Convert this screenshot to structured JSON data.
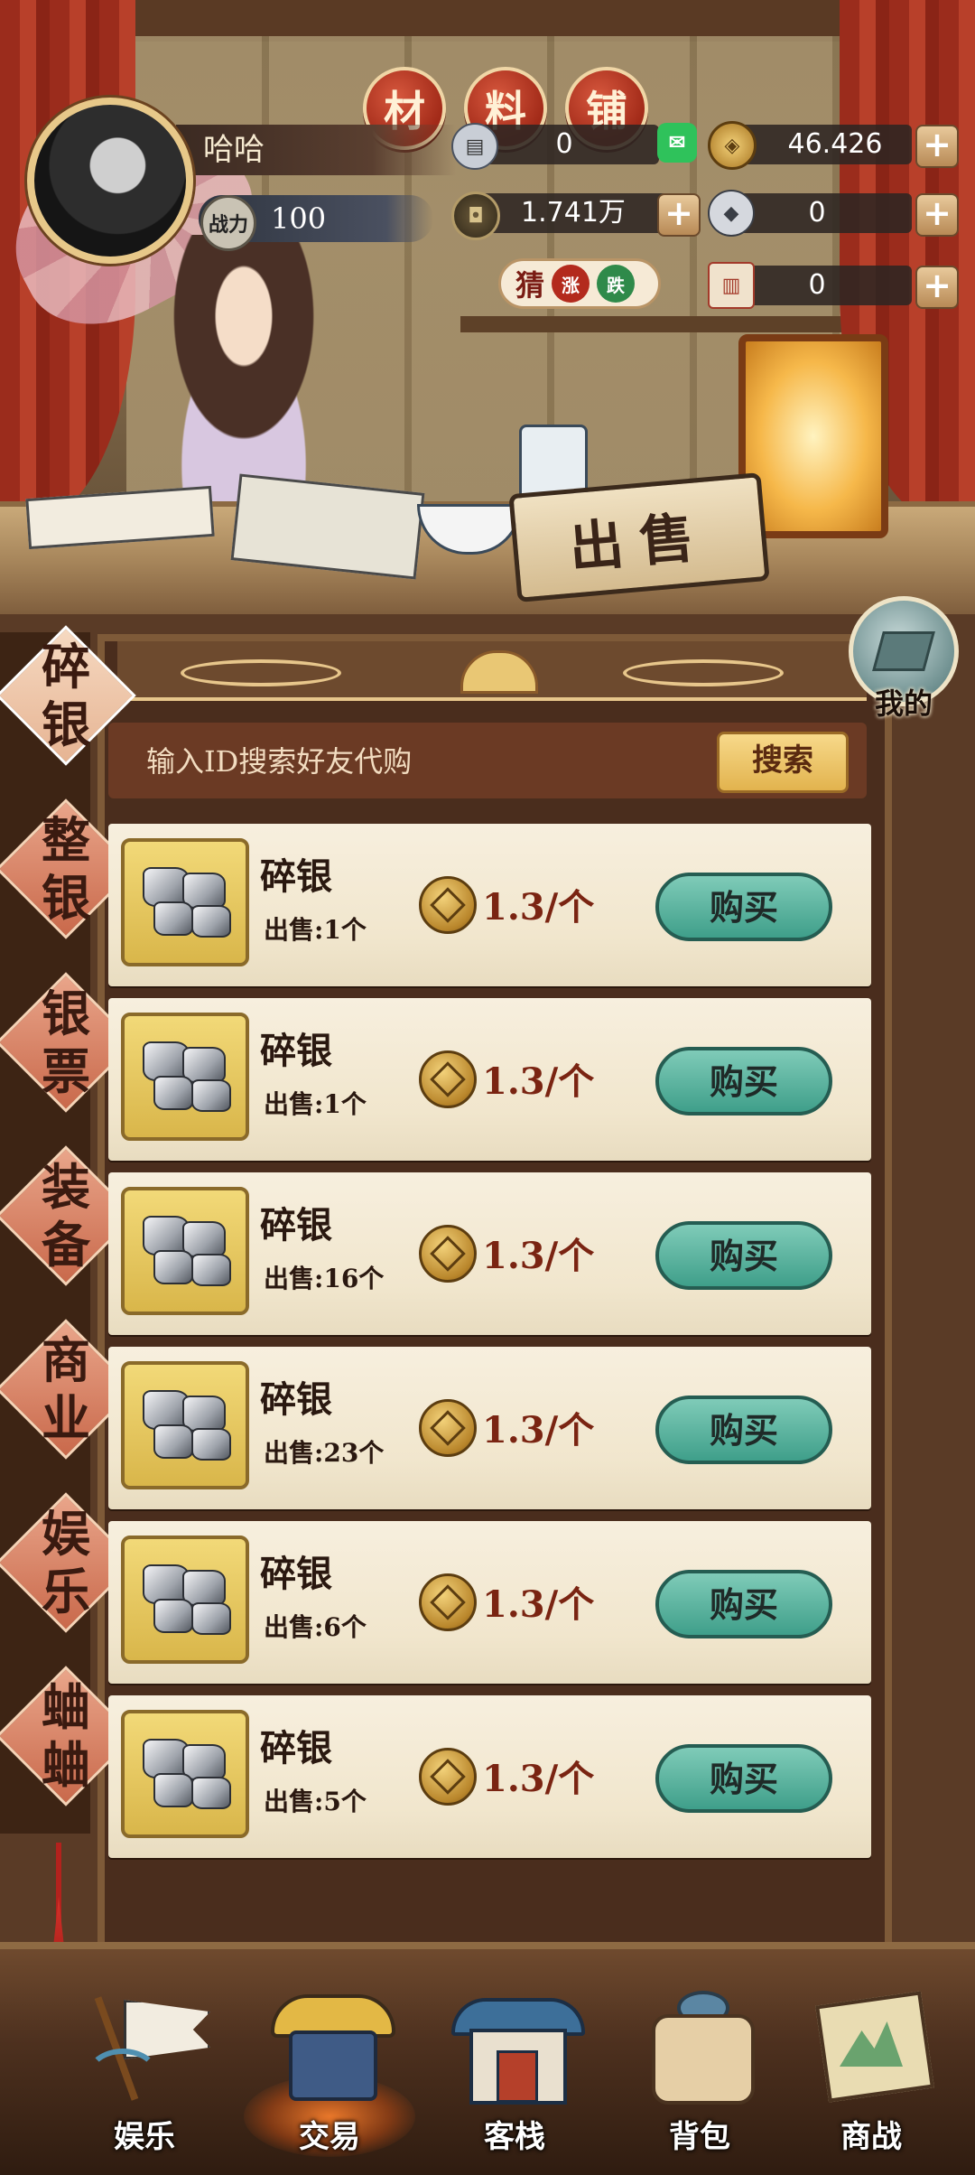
{
  "shop_title": [
    "材",
    "料",
    "铺"
  ],
  "player": {
    "name": "哈哈",
    "power_icon_label": "战力",
    "power": "100"
  },
  "resources": {
    "silver_bills": "0",
    "gold_ingots": "46.426",
    "copper_coins": "1.741万",
    "silver_chunks": "0",
    "tickets": "0"
  },
  "guess_badge": {
    "label": "猜",
    "rise": "涨",
    "fall": "跌"
  },
  "sell_sign": "出售",
  "mine_button": "我的",
  "side_tabs": [
    {
      "label": "碎银",
      "active": true
    },
    {
      "label": "整银",
      "active": false
    },
    {
      "label": "银票",
      "active": false
    },
    {
      "label": "装备",
      "active": false
    },
    {
      "label": "商业",
      "active": false
    },
    {
      "label": "娱乐",
      "active": false
    },
    {
      "label": "蛐蛐",
      "active": false
    }
  ],
  "search": {
    "placeholder": "输入ID搜索好友代购",
    "button": "搜索"
  },
  "listings": [
    {
      "name": "碎银",
      "sold": "出售:1个",
      "price": "1.3/个",
      "buy": "购买"
    },
    {
      "name": "碎银",
      "sold": "出售:1个",
      "price": "1.3/个",
      "buy": "购买"
    },
    {
      "name": "碎银",
      "sold": "出售:16个",
      "price": "1.3/个",
      "buy": "购买"
    },
    {
      "name": "碎银",
      "sold": "出售:23个",
      "price": "1.3/个",
      "buy": "购买"
    },
    {
      "name": "碎银",
      "sold": "出售:6个",
      "price": "1.3/个",
      "buy": "购买"
    },
    {
      "name": "碎银",
      "sold": "出售:5个",
      "price": "1.3/个",
      "buy": "购买"
    }
  ],
  "bottom_nav": [
    {
      "label": "娱乐",
      "icon": "flag-icon",
      "active": false
    },
    {
      "label": "交易",
      "icon": "trade-hat-icon",
      "active": true
    },
    {
      "label": "客栈",
      "icon": "inn-gate-icon",
      "active": false
    },
    {
      "label": "背包",
      "icon": "bag-icon",
      "active": false
    },
    {
      "label": "商战",
      "icon": "scroll-map-icon",
      "active": false
    }
  ],
  "colors": {
    "accent_red": "#a22a18",
    "buy_green": "#3f9f8a",
    "gold": "#e2b34e",
    "panel_brown": "#4a2d1d"
  }
}
